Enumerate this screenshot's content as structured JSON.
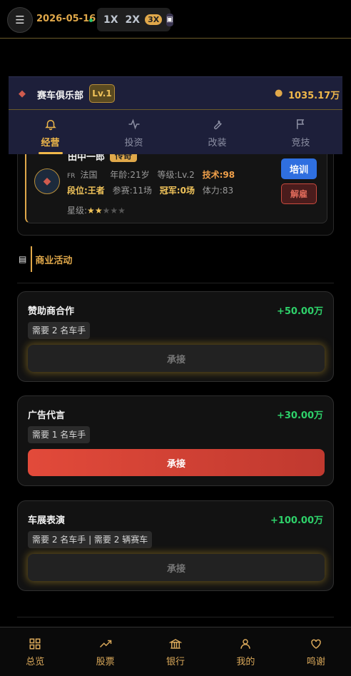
{
  "topbar": {
    "date": "2026-05-16",
    "speeds": [
      "1X",
      "2X",
      "3X"
    ],
    "active_speed": "3X"
  },
  "club": {
    "name": "赛车俱乐部",
    "level": "Lv.1",
    "money": "1035.17万"
  },
  "tabs": [
    {
      "label": "经营",
      "icon": "bell-icon",
      "active": true
    },
    {
      "label": "投资",
      "icon": "activity-icon",
      "active": false
    },
    {
      "label": "改装",
      "icon": "wrench-icon",
      "active": false
    },
    {
      "label": "竞技",
      "icon": "flag-icon",
      "active": false
    }
  ],
  "driver": {
    "name": "田中一郎",
    "tag": "传奇",
    "flag": "FR",
    "country": "法国",
    "age": "年龄:21岁",
    "level": "等级:Lv.2",
    "skill": "技术:98",
    "rank": "段位:王者",
    "races": "参赛:11场",
    "champs": "冠军:0场",
    "stamina": "体力:83",
    "stars_label": "星级:",
    "stars": 2,
    "stars_max": 5,
    "train_label": "培训",
    "fire_label": "解雇"
  },
  "section": {
    "title": "商业活动"
  },
  "activities": [
    {
      "title": "赞助商合作",
      "reward": "+50.00万",
      "requirement": "需要 2 名车手",
      "button": "承接",
      "enabled": false
    },
    {
      "title": "广告代言",
      "reward": "+30.00万",
      "requirement": "需要 1 名车手",
      "button": "承接",
      "enabled": true
    },
    {
      "title": "车展表演",
      "reward": "+100.00万",
      "requirement": "需要 2 名车手 | 需要 2 辆赛车",
      "button": "承接",
      "enabled": false
    }
  ],
  "bottom_nav": [
    {
      "label": "总览",
      "icon": "grid-icon"
    },
    {
      "label": "股票",
      "icon": "trending-up-icon"
    },
    {
      "label": "银行",
      "icon": "bank-icon"
    },
    {
      "label": "我的",
      "icon": "user-icon"
    },
    {
      "label": "鸣谢",
      "icon": "heart-icon"
    }
  ],
  "colors": {
    "accent": "#e0a84a",
    "positive": "#2ed16a",
    "panel": "#1d1f3a",
    "danger": "#c94a3e",
    "primary": "#2f6fe0"
  }
}
